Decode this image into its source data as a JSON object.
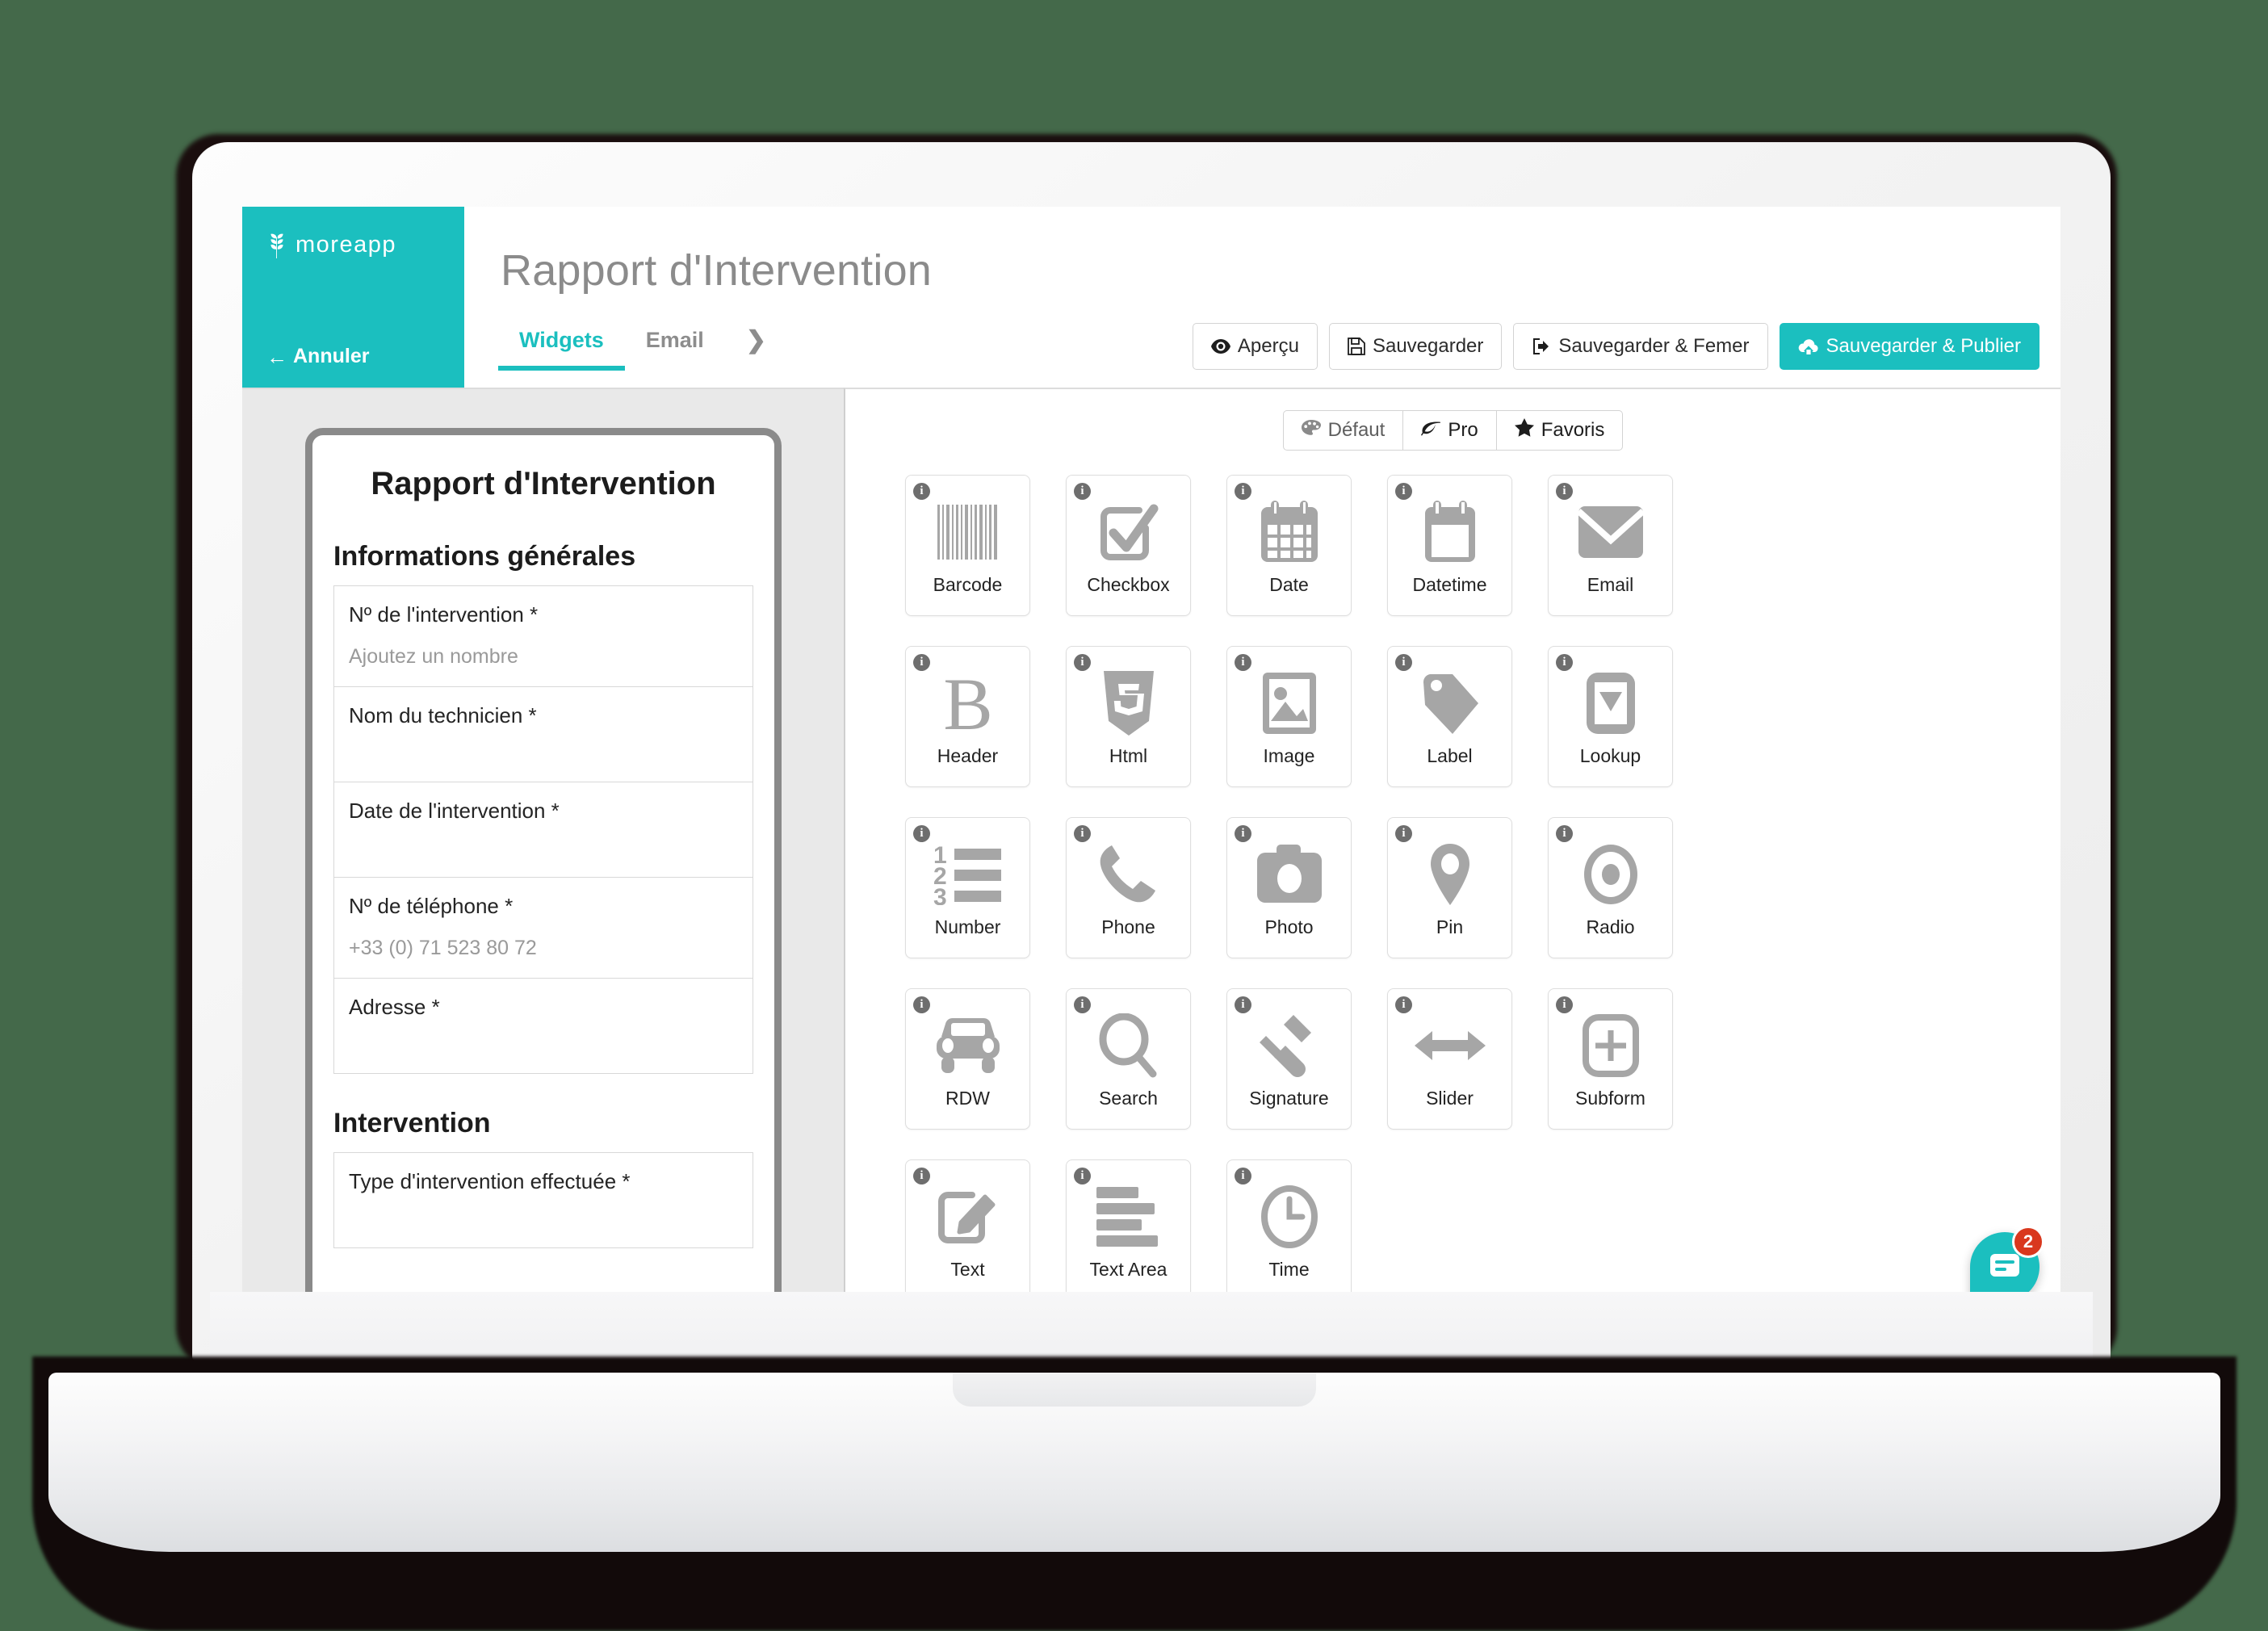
{
  "brand": {
    "name": "moreapp",
    "logo_icon": "wheat-icon",
    "cancel_label": "Annuler",
    "cancel_icon": "arrow-left-icon",
    "accent_color": "#1bbfbf"
  },
  "header": {
    "title": "Rapport d'Intervention"
  },
  "tabs": [
    {
      "label": "Widgets",
      "active": true
    },
    {
      "label": "Email",
      "active": false
    },
    {
      "label": "❯",
      "active": false,
      "icon": "chevron-right-icon"
    }
  ],
  "toolbar": [
    {
      "label": "Aperçu",
      "icon": "eye-icon",
      "primary": false
    },
    {
      "label": "Sauvegarder",
      "icon": "floppy-disk-icon",
      "primary": false
    },
    {
      "label": "Sauvegarder & Femer",
      "icon": "sign-out-icon",
      "primary": false
    },
    {
      "label": "Sauvegarder & Publier",
      "icon": "cloud-upload-icon",
      "primary": true
    }
  ],
  "preview": {
    "form_title": "Rapport d'Intervention",
    "sections": [
      {
        "heading": "Informations générales",
        "fields": [
          {
            "label": "Nº de l'intervention *",
            "placeholder": "Ajoutez un nombre"
          },
          {
            "label": "Nom du technicien *",
            "placeholder": ""
          },
          {
            "label": "Date de l'intervention *",
            "placeholder": ""
          },
          {
            "label": "Nº de téléphone *",
            "placeholder": "+33 (0) 71 523 80 72"
          },
          {
            "label": "Adresse *",
            "placeholder": ""
          }
        ]
      },
      {
        "heading": "Intervention",
        "fields": [
          {
            "label": "Type d'intervention effectuée *",
            "placeholder": ""
          }
        ]
      }
    ]
  },
  "filters": [
    {
      "label": "Défaut",
      "icon": "palette-icon",
      "active": false
    },
    {
      "label": "Pro",
      "icon": "leaf-icon",
      "active": true
    },
    {
      "label": "Favoris",
      "icon": "star-icon",
      "active": true
    }
  ],
  "widgets": [
    {
      "label": "Barcode",
      "icon": "barcode-icon",
      "info": "i"
    },
    {
      "label": "Checkbox",
      "icon": "checkbox-icon",
      "info": "i"
    },
    {
      "label": "Date",
      "icon": "calendar-icon",
      "info": "i"
    },
    {
      "label": "Datetime",
      "icon": "calendar-blank-icon",
      "info": "i"
    },
    {
      "label": "Email",
      "icon": "envelope-icon",
      "info": "i"
    },
    {
      "label": "Header",
      "icon": "bold-b-icon",
      "info": "i"
    },
    {
      "label": "Html",
      "icon": "html5-icon",
      "info": "i"
    },
    {
      "label": "Image",
      "icon": "image-icon",
      "info": "i"
    },
    {
      "label": "Label",
      "icon": "tag-icon",
      "info": "i"
    },
    {
      "label": "Lookup",
      "icon": "dropdown-icon",
      "info": "i"
    },
    {
      "label": "Number",
      "icon": "numbered-list-icon",
      "info": "i"
    },
    {
      "label": "Phone",
      "icon": "phone-icon",
      "info": "i"
    },
    {
      "label": "Photo",
      "icon": "camera-icon",
      "info": "i"
    },
    {
      "label": "Pin",
      "icon": "map-pin-icon",
      "info": "i"
    },
    {
      "label": "Radio",
      "icon": "radio-button-icon",
      "info": "i"
    },
    {
      "label": "RDW",
      "icon": "car-icon",
      "info": "i"
    },
    {
      "label": "Search",
      "icon": "magnifier-icon",
      "info": "i"
    },
    {
      "label": "Signature",
      "icon": "gavel-icon",
      "info": "i"
    },
    {
      "label": "Slider",
      "icon": "arrows-horizontal-icon",
      "info": "i"
    },
    {
      "label": "Subform",
      "icon": "plus-square-icon",
      "info": "i"
    },
    {
      "label": "Text",
      "icon": "pencil-edit-icon",
      "info": "i"
    },
    {
      "label": "Text Area",
      "icon": "text-lines-icon",
      "info": "i"
    },
    {
      "label": "Time",
      "icon": "clock-icon",
      "info": "i"
    }
  ],
  "chat": {
    "icon": "chat-bubble-icon",
    "unread_count": "2",
    "badge_color": "#d9381e"
  }
}
